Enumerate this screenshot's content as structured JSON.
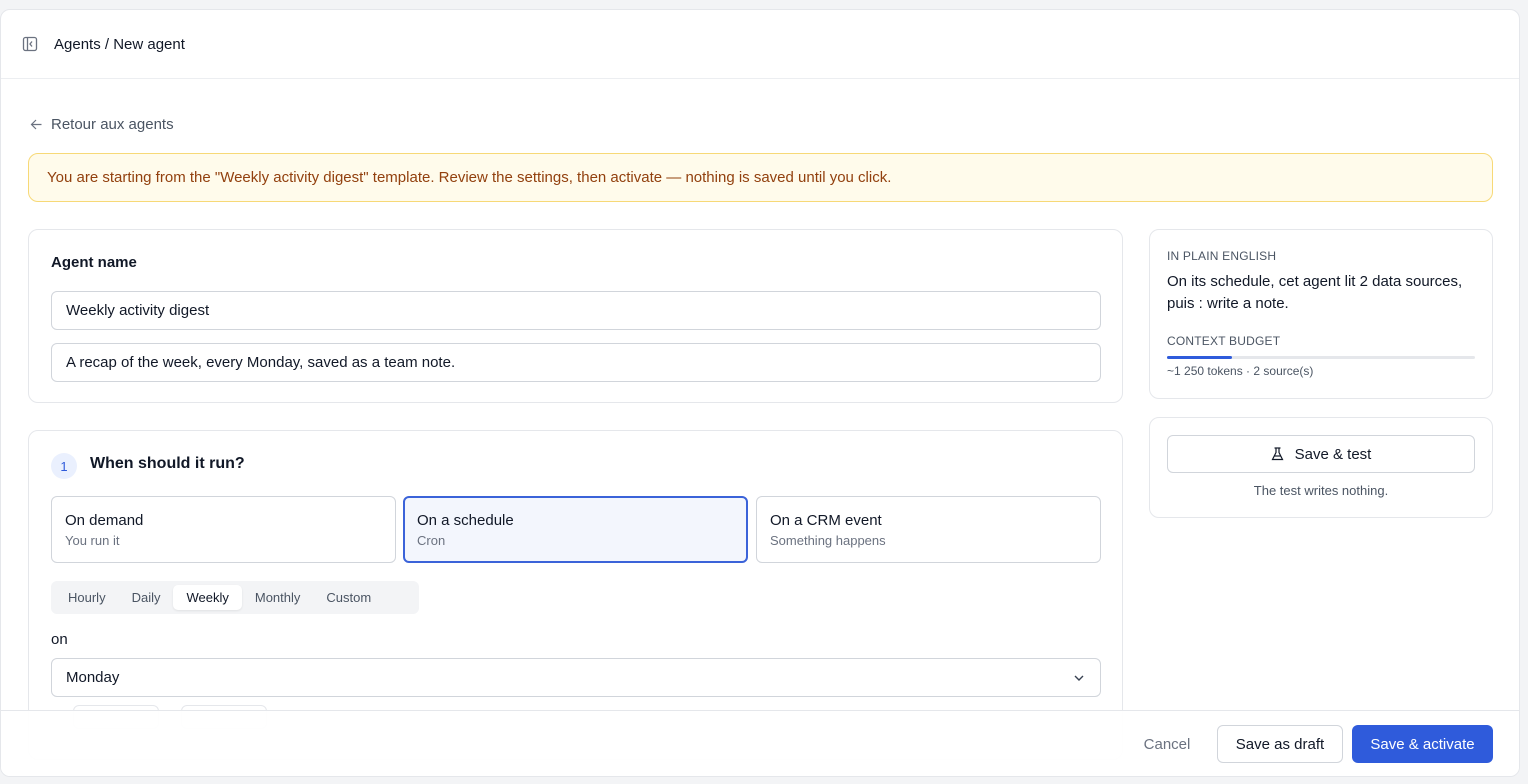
{
  "header": {
    "breadcrumb": "Agents / New agent",
    "sidebar_icon": "sidebar-toggle-icon"
  },
  "back_link": {
    "label": "Retour aux agents",
    "icon": "arrow-left-icon"
  },
  "banner": {
    "text": "You are starting from the \"Weekly activity digest\" template. Review the settings, then activate — nothing is saved until you click."
  },
  "agent": {
    "name_label": "Agent name",
    "name_value": "Weekly activity digest",
    "description_value": "A recap of the week, every Monday, saved as a team note."
  },
  "run": {
    "step_number": "1",
    "title": "When should it run?",
    "options": [
      {
        "title": "On demand",
        "subtitle": "You run it",
        "selected": false
      },
      {
        "title": "On a schedule",
        "subtitle": "Cron",
        "selected": true
      },
      {
        "title": "On a CRM event",
        "subtitle": "Something happens",
        "selected": false
      }
    ],
    "frequency_tabs": [
      "Hourly",
      "Daily",
      "Weekly",
      "Monthly",
      "Custom"
    ],
    "frequency_selected": "Weekly",
    "on_label": "on",
    "day_value": "Monday"
  },
  "summary": {
    "plain_label": "IN PLAIN ENGLISH",
    "plain_text": "On its schedule, cet agent lit 2 data sources, puis : write a note.",
    "budget_label": "CONTEXT BUDGET",
    "budget_fraction": 0.21,
    "budget_info": "~1 250 tokens · 2 source(s)"
  },
  "test": {
    "button_label": "Save & test",
    "icon": "flask-icon",
    "note": "The test writes nothing."
  },
  "footer": {
    "cancel": "Cancel",
    "draft": "Save as draft",
    "activate": "Save & activate"
  },
  "colors": {
    "accent": "#2f5bdb",
    "banner_bg": "#fffbeb",
    "banner_border": "#f7d977",
    "banner_text": "#92400e"
  }
}
